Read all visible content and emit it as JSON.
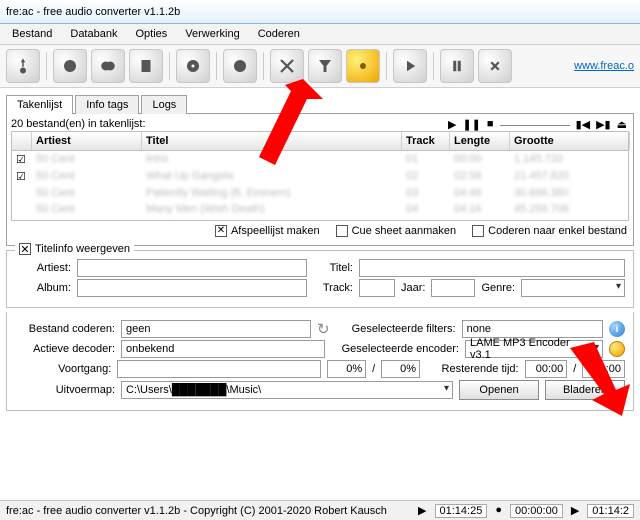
{
  "window": {
    "title": "fre:ac - free audio converter v1.1.2b"
  },
  "menu": {
    "items": [
      "Bestand",
      "Databank",
      "Opties",
      "Verwerking",
      "Coderen"
    ]
  },
  "link": "www.freac.o",
  "tabs": {
    "items": [
      "Takenlijst",
      "Info tags",
      "Logs"
    ],
    "active": 0
  },
  "list": {
    "count_text": "20 bestand(en) in takenlijst:",
    "headers": [
      "",
      "Artiest",
      "Titel",
      "Track",
      "Lengte",
      "Grootte"
    ],
    "rows": [
      {
        "artist": "50 Cent",
        "title": "Intro",
        "track": "01",
        "length": "00:00",
        "size": "1.145.720"
      },
      {
        "artist": "50 Cent",
        "title": "What Up Gangsta",
        "track": "02",
        "length": "02:58",
        "size": "21.457.820"
      },
      {
        "artist": "50 Cent",
        "title": "Patiently Waiting (ft. Eminem)",
        "track": "03",
        "length": "04:48",
        "size": "30.696.380"
      },
      {
        "artist": "50 Cent",
        "title": "Many Men (Wish Death)",
        "track": "04",
        "length": "04:16",
        "size": "45.259.706"
      }
    ]
  },
  "opts": {
    "playlist": "Afspeellijst maken",
    "cuesheet": "Cue sheet aanmaken",
    "single": "Coderen naar enkel bestand"
  },
  "titleinfo": {
    "legend": "Titelinfo weergeven",
    "artist_l": "Artiest:",
    "title_l": "Titel:",
    "album_l": "Album:",
    "track_l": "Track:",
    "year_l": "Jaar:",
    "genre_l": "Genre:"
  },
  "enc": {
    "file_l": "Bestand coderen:",
    "file_v": "geen",
    "filters_l": "Geselecteerde filters:",
    "filters_v": "none",
    "decoder_l": "Actieve decoder:",
    "decoder_v": "onbekend",
    "encoder_l": "Geselecteerde encoder:",
    "encoder_v": "LAME MP3 Encoder v3.1",
    "progress_l": "Voortgang:",
    "pct1": "0%",
    "slash": "/",
    "pct2": "0%",
    "remain_l": "Resterende tijd:",
    "t1": "00:00",
    "t2": "00:00",
    "out_l": "Uitvoermap:",
    "out_v": "C:\\Users\\███████\\Music\\",
    "open": "Openen",
    "browse": "Bladeren"
  },
  "status": {
    "text": "fre:ac - free audio converter v1.1.2b - Copyright (C) 2001-2020 Robert Kausch",
    "t1": "01:14:25",
    "t2": "00:00:00",
    "t3": "01:14:2"
  }
}
